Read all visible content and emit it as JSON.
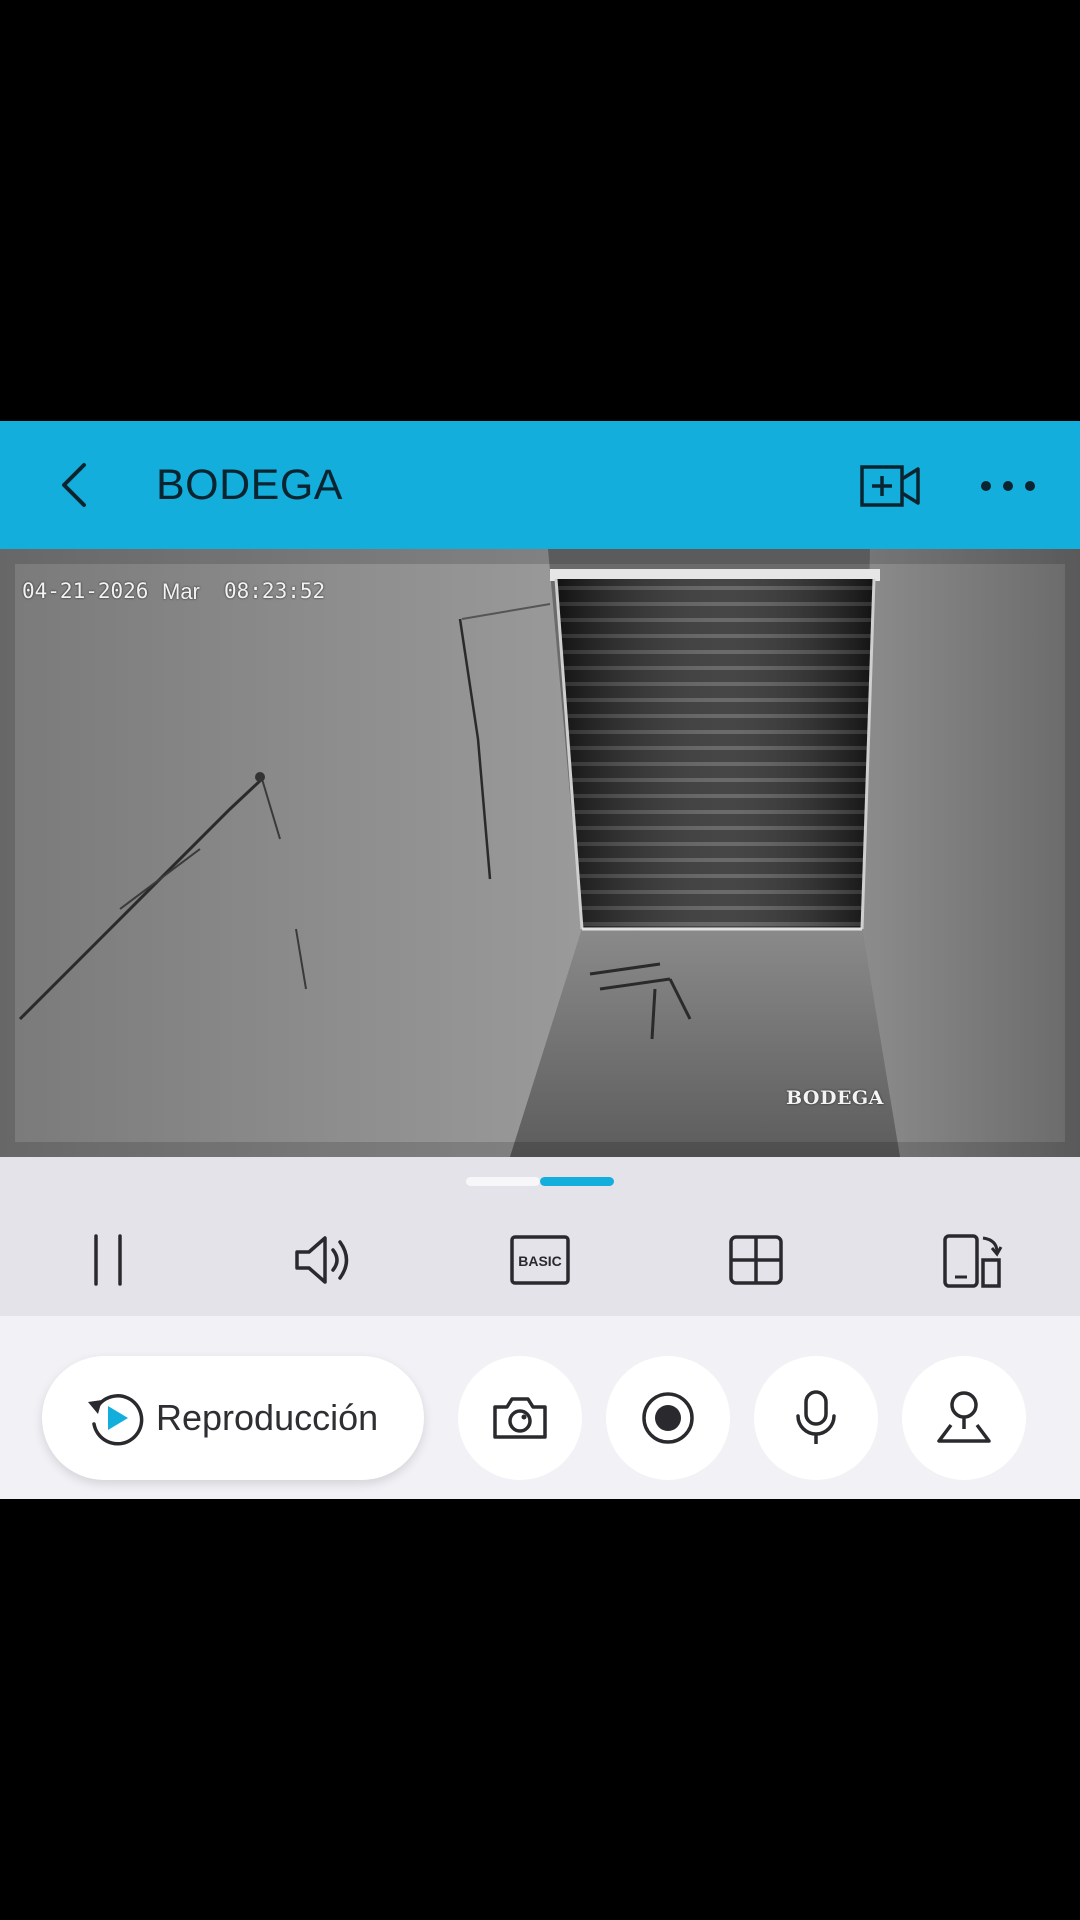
{
  "header": {
    "title": "BODEGA",
    "back_icon": "chevron-left-icon",
    "add_camera_icon": "add-video-icon",
    "more_icon": "more-horizontal-icon",
    "background_color": "#13aedc"
  },
  "video": {
    "osd_date": "04-21-2026",
    "osd_weekday": "Mar",
    "osd_time": "08:23:52",
    "osd_camera_label": "BODEGA"
  },
  "controls": {
    "pager": {
      "pages": 2,
      "active_index": 1
    },
    "buttons": [
      {
        "name": "pause",
        "icon": "pause-icon"
      },
      {
        "name": "volume",
        "icon": "speaker-icon"
      },
      {
        "name": "quality",
        "icon": "basic-quality-icon",
        "label": "BASIC"
      },
      {
        "name": "split-view",
        "icon": "grid-icon"
      },
      {
        "name": "rotate",
        "icon": "rotate-device-icon"
      }
    ]
  },
  "actions": {
    "playback_label": "Reproducción",
    "playback_icon": "replay-icon",
    "buttons": [
      {
        "name": "snapshot",
        "icon": "camera-icon"
      },
      {
        "name": "record",
        "icon": "record-icon"
      },
      {
        "name": "talk",
        "icon": "microphone-icon"
      },
      {
        "name": "ptz",
        "icon": "ptz-icon"
      }
    ],
    "accent_color": "#13aedc"
  }
}
